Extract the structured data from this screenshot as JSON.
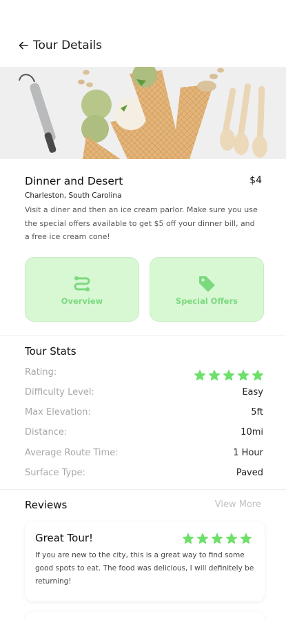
{
  "header": {
    "title": "Tour Details",
    "back_icon": "arrow-left-icon"
  },
  "hero": {
    "alt": "ice-cream-cones-image"
  },
  "tour": {
    "name": "Dinner and Desert",
    "price": "$4",
    "location": "Charleston, South Carolina",
    "description": "Visit a diner and then an ice cream parlor. Make sure you use the special offers available to get $5 off your dinner bill, and a free ice cream cone!"
  },
  "actions": [
    {
      "label": "Overview",
      "icon": "route-icon"
    },
    {
      "label": "Special Offers",
      "icon": "tag-icon"
    }
  ],
  "stats": {
    "title": "Tour Stats",
    "rating_label": "Rating:",
    "rating_value": 5,
    "rows": [
      {
        "label": "Difficulty Level:",
        "value": "Easy"
      },
      {
        "label": "Max Elevation:",
        "value": "5ft"
      },
      {
        "label": "Distance:",
        "value": "10mi"
      },
      {
        "label": "Average Route Time:",
        "value": "1 Hour"
      },
      {
        "label": "Surface Type:",
        "value": "Paved"
      }
    ]
  },
  "reviews": {
    "title": "Reviews",
    "view_more": "View More",
    "items": [
      {
        "title": "Great Tour!",
        "rating": 5,
        "body": "If you are new to the city, this is a great way to find some good spots to eat. The food was delicious, I will definitely be returning!"
      }
    ]
  },
  "colors": {
    "accent": "#7bd97e",
    "card_bg": "#d8f8d4",
    "star": "#6ee06a",
    "muted": "#a8a8a8"
  }
}
